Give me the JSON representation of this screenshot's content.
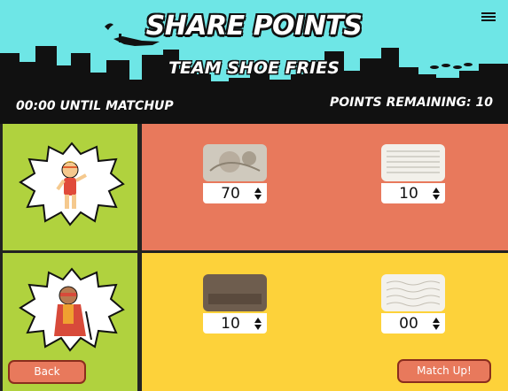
{
  "header": {
    "title": "SHARE POINTS",
    "team": "TEAM SHOE FRIES",
    "timer": "00:00 UNTIL MATCHUP",
    "points_remaining": "POINTS REMAINING: 10"
  },
  "rows": [
    {
      "avatar": "girl-hero-avatar",
      "shoes": [
        {
          "value": "70",
          "thumb": "floral-shoe-thumbnail"
        },
        {
          "value": "10",
          "thumb": "newsprint-shoe-thumbnail"
        }
      ]
    },
    {
      "avatar": "boy-hero-avatar",
      "shoes": [
        {
          "value": "10",
          "thumb": "brown-shoe-thumbnail"
        },
        {
          "value": "00",
          "thumb": "script-shoe-thumbnail"
        }
      ]
    }
  ],
  "buttons": {
    "back": "Back",
    "match_up": "Match Up!"
  },
  "colors": {
    "sky": "#6ee6e6",
    "avatar_bg": "#b0d23e",
    "row1_bg": "#e8795c",
    "row2_bg": "#fdd23a",
    "button": "#e8795c"
  }
}
